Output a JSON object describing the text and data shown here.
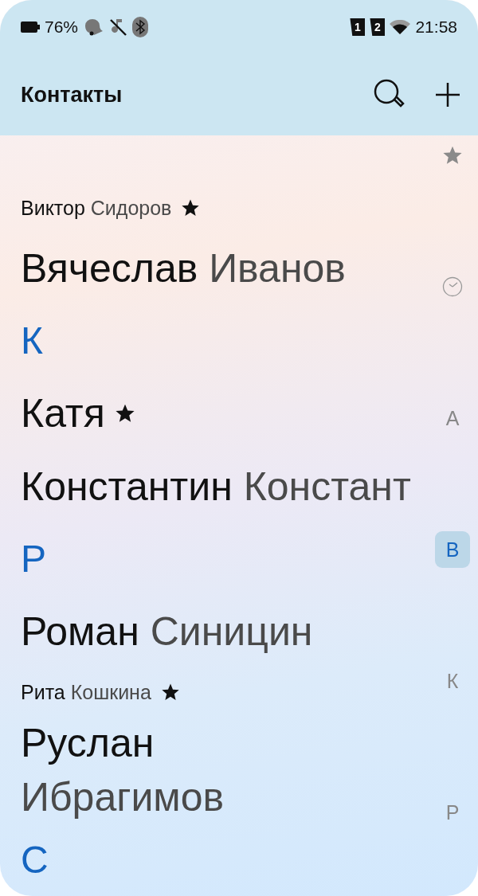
{
  "status_bar": {
    "battery": "76%",
    "sims": [
      "1",
      "2"
    ],
    "time": "21:58"
  },
  "app_bar": {
    "title": "Контакты"
  },
  "contacts": [
    {
      "kind": "contact_small",
      "first": "Виктор",
      "last": "Сидоров",
      "favorite": true
    },
    {
      "kind": "contact",
      "first": "Вячеслав",
      "last": "Иванов",
      "favorite": false
    },
    {
      "kind": "header",
      "letter": "К"
    },
    {
      "kind": "contact",
      "first": "Катя",
      "favorite": true
    },
    {
      "kind": "contact",
      "first": "Константин",
      "last": "Констант",
      "favorite": false
    },
    {
      "kind": "header",
      "letter": "Р"
    },
    {
      "kind": "contact",
      "first": "Роман",
      "last": "Синицин",
      "favorite": false
    },
    {
      "kind": "contact_small",
      "first": "Рита",
      "last": "Кошкина",
      "favorite": true
    },
    {
      "kind": "contact_wrapped",
      "first": "Руслан",
      "last": "Ибрагимов",
      "favorite": false
    },
    {
      "kind": "header",
      "letter": "С"
    }
  ],
  "index": [
    {
      "kind": "star",
      "selected": false
    },
    {
      "kind": "clock",
      "selected": false
    },
    {
      "kind": "letter",
      "label": "А",
      "selected": false
    },
    {
      "kind": "letter",
      "label": "В",
      "selected": true
    },
    {
      "kind": "letter",
      "label": "К",
      "selected": false
    },
    {
      "kind": "letter",
      "label": "Р",
      "selected": false
    }
  ]
}
